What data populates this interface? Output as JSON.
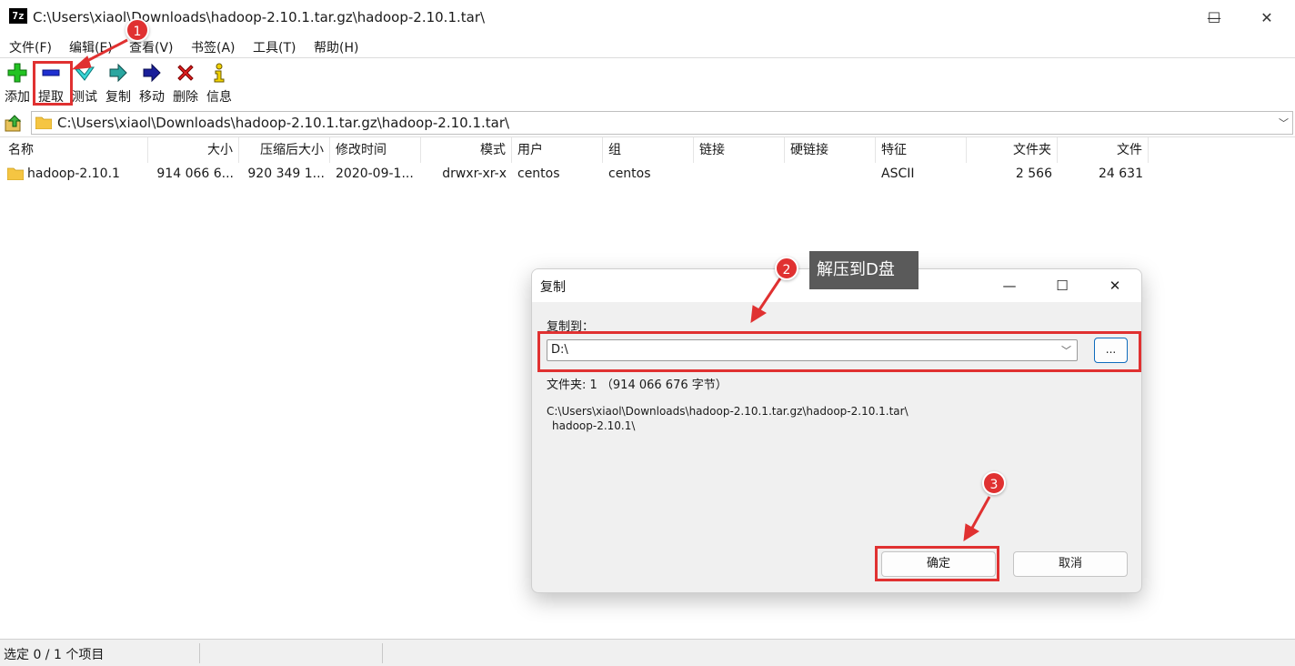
{
  "window": {
    "icon_text": "7z",
    "title": "C:\\Users\\xiaol\\Downloads\\hadoop-2.10.1.tar.gz\\hadoop-2.10.1.tar\\",
    "minimize": "—",
    "maximize": "☐",
    "close": "✕"
  },
  "menu": [
    "文件(F)",
    "编辑(E)",
    "查看(V)",
    "书签(A)",
    "工具(T)",
    "帮助(H)"
  ],
  "toolbar": {
    "add": "添加",
    "extract": "提取",
    "test": "测试",
    "copy": "复制",
    "move": "移动",
    "delete": "删除",
    "info": "信息"
  },
  "address": {
    "path": "C:\\Users\\xiaol\\Downloads\\hadoop-2.10.1.tar.gz\\hadoop-2.10.1.tar\\"
  },
  "columns": [
    "名称",
    "大小",
    "压缩后大小",
    "修改时间",
    "模式",
    "用户",
    "组",
    "链接",
    "硬链接",
    "特征",
    "文件夹",
    "文件"
  ],
  "rows": [
    {
      "name": "hadoop-2.10.1",
      "size": "914 066 6...",
      "packed": "920 349 1...",
      "modified": "2020-09-1...",
      "mode": "drwxr-xr-x",
      "user": "centos",
      "group": "centos",
      "link": "",
      "hardlink": "",
      "characteristics": "ASCII",
      "folders": "2 566",
      "files": "24 631"
    }
  ],
  "status": {
    "selection": "选定 0 / 1 个项目"
  },
  "dialog": {
    "title": "复制",
    "copy_to_label": "复制到：",
    "destination": "D:\\",
    "browse": "...",
    "info": "文件夹: 1  （914 066 676 字节）",
    "path_line1": "C:\\Users\\xiaol\\Downloads\\hadoop-2.10.1.tar.gz\\hadoop-2.10.1.tar\\",
    "path_line2": "hadoop-2.10.1\\",
    "ok": "确定",
    "cancel": "取消"
  },
  "annotations": {
    "badge1": "1",
    "badge2": "2",
    "badge3": "3",
    "tooltip": "解压到D盘",
    "accent": "#e03131"
  }
}
